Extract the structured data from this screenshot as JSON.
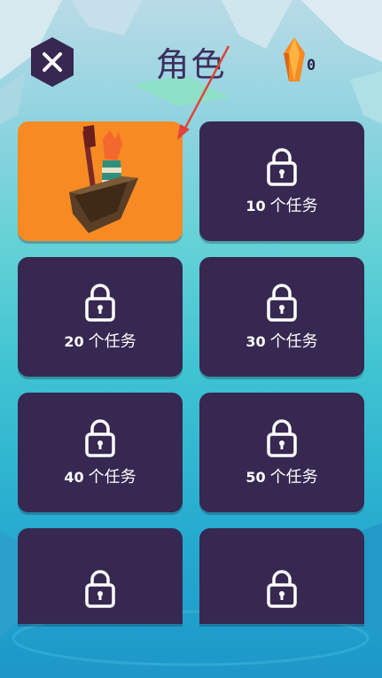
{
  "header": {
    "title": "角色",
    "close_icon": "close-icon",
    "gem_icon": "orange-crystal-icon",
    "gem_count": "0"
  },
  "characters": [
    {
      "id": "fox-boat",
      "locked": false,
      "selected": true,
      "image": "fox-in-boat"
    },
    {
      "locked": true,
      "count": "10",
      "suffix": "个任务"
    },
    {
      "locked": true,
      "count": "20",
      "suffix": "个任务"
    },
    {
      "locked": true,
      "count": "30",
      "suffix": "个任务"
    },
    {
      "locked": true,
      "count": "40",
      "suffix": "个任务"
    },
    {
      "locked": true,
      "count": "50",
      "suffix": "个任务"
    },
    {
      "locked": true
    },
    {
      "locked": true
    }
  ],
  "colors": {
    "card_bg": "#362851",
    "selected_bg": "#f78a22",
    "title": "#3c2f5f",
    "annotation_arrow": "#e0443a"
  }
}
